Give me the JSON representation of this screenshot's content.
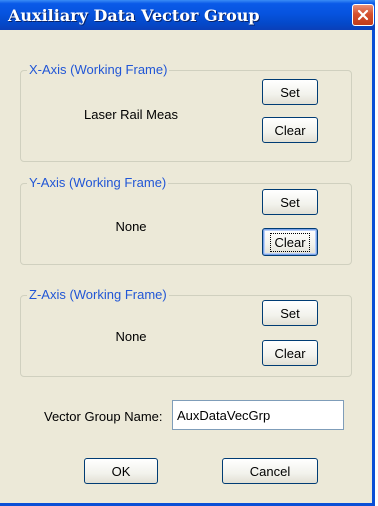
{
  "dialog": {
    "title": "Auxiliary Data Vector Group",
    "close_icon": "close-icon"
  },
  "groups": [
    {
      "legend": "X-Axis (Working Frame)",
      "value": "Laser Rail Meas",
      "set_label": "Set",
      "clear_label": "Clear"
    },
    {
      "legend": "Y-Axis (Working Frame)",
      "value": "None",
      "set_label": "Set",
      "clear_label": "Clear"
    },
    {
      "legend": "Z-Axis (Working Frame)",
      "value": "None",
      "set_label": "Set",
      "clear_label": "Clear"
    }
  ],
  "vector_group": {
    "label": "Vector Group Name:",
    "value": "AuxDataVecGrp"
  },
  "footer": {
    "ok_label": "OK",
    "cancel_label": "Cancel"
  },
  "colors": {
    "title_bar": "#0653df",
    "dialog_face": "#ece9d8",
    "group_legend": "#2156d6",
    "close_button": "#d4502e"
  }
}
